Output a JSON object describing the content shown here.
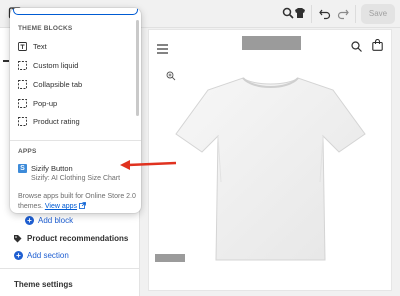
{
  "toolbar": {
    "save_label": "Save"
  },
  "popover": {
    "theme_blocks_heading": "THEME BLOCKS",
    "theme_blocks": [
      {
        "label": "Text",
        "icon": "text-icon"
      },
      {
        "label": "Custom liquid",
        "icon": "dashed-square-icon"
      },
      {
        "label": "Collapsible tab",
        "icon": "dashed-square-icon"
      },
      {
        "label": "Pop-up",
        "icon": "dashed-square-icon"
      },
      {
        "label": "Product rating",
        "icon": "dashed-square-icon"
      }
    ],
    "apps_heading": "APPS",
    "app": {
      "name": "Sizify Button",
      "description": "Sizify: AI Clothing Size Chart",
      "logo_letter": "S"
    },
    "browse_text": "Browse apps built for Online Store 2.0 themes.",
    "view_apps_label": "View apps"
  },
  "sidebar": {
    "add_block_label": "Add block",
    "product_recommendations_label": "Product recommendations",
    "add_section_label": "Add section",
    "theme_settings_label": "Theme settings"
  },
  "colors": {
    "accent": "#005bd3",
    "link": "#1f5fd1",
    "arrow": "#e0321f"
  }
}
